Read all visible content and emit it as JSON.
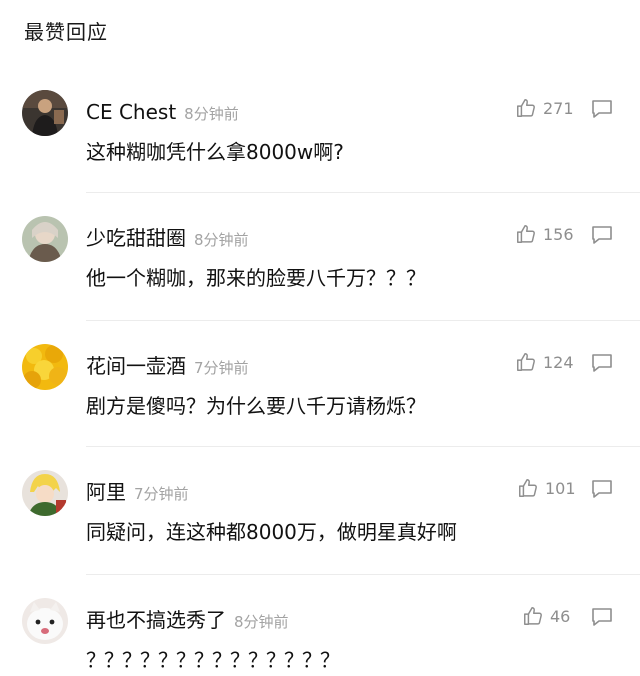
{
  "section_title": "最赞回应",
  "comments": [
    {
      "user": "CE Chest",
      "time": "8分钟前",
      "text": "这种糊咖凭什么拿8000w啊?",
      "likes": "271"
    },
    {
      "user": "少吃甜甜圈",
      "time": "8分钟前",
      "text": "他一个糊咖，那来的脸要八千万？？？",
      "likes": "156"
    },
    {
      "user": "花间一壶酒",
      "time": "7分钟前",
      "text": "剧方是傻吗？为什么要八千万请杨烁？",
      "likes": "124"
    },
    {
      "user": "阿里",
      "time": "7分钟前",
      "text": "同疑问，连这种都8000万，做明星真好啊",
      "likes": "101"
    },
    {
      "user": "再也不搞选秀了",
      "time": "8分钟前",
      "text": "？？？？？？？？？？？？？？",
      "likes": "46"
    }
  ],
  "icons": {
    "like": "thumbs-up-icon",
    "reply": "comment-bubble-icon"
  },
  "colors": {
    "text": "#111111",
    "muted": "#a3a3a3",
    "icon": "#8e8e8e",
    "divider": "#ececec"
  }
}
